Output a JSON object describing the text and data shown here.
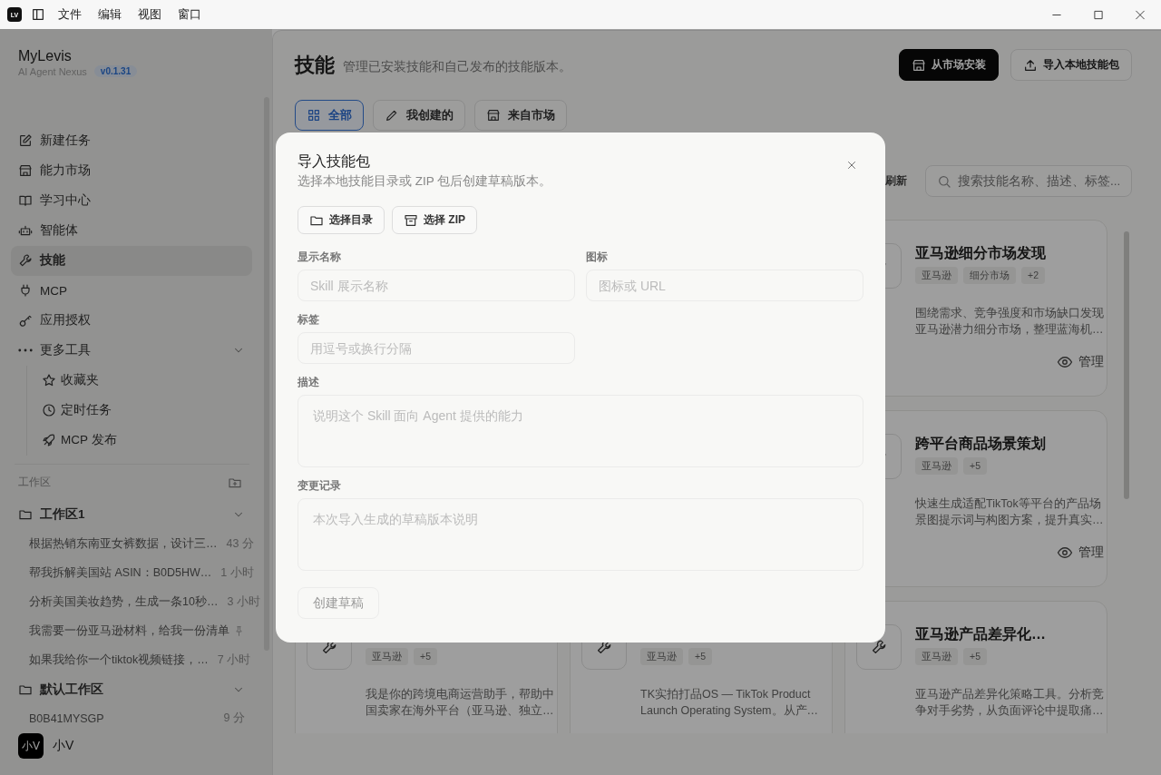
{
  "titlebar": {
    "logo": "LV",
    "menus": [
      "文件",
      "编辑",
      "视图",
      "窗口"
    ]
  },
  "sidebar": {
    "brand": "MyLevis",
    "tagline": "AI Agent Nexus",
    "version": "v0.1.31",
    "nav": [
      {
        "label": "新建任务",
        "selected": false
      },
      {
        "label": "能力市场",
        "selected": false
      },
      {
        "label": "学习中心",
        "selected": false
      },
      {
        "label": "智能体",
        "selected": false
      },
      {
        "label": "技能",
        "selected": true
      },
      {
        "label": "MCP",
        "selected": false
      },
      {
        "label": "应用授权",
        "selected": false
      },
      {
        "label": "更多工具",
        "selected": false,
        "expanded": true,
        "children": [
          {
            "label": "收藏夹",
            "selected": false
          },
          {
            "label": "定时任务",
            "selected": false
          },
          {
            "label": "MCP 发布",
            "selected": false
          }
        ]
      }
    ],
    "workspace_heading": "工作区",
    "workspaces": [
      {
        "name": "工作区1",
        "expanded": true,
        "tasks": [
          {
            "title": "根据热销东南亚女裤数据，设计三…",
            "time": "43 分",
            "pinned": false
          },
          {
            "title": "帮我拆解美国站 ASIN：B0D5HW…",
            "time": "1 小时",
            "pinned": false
          },
          {
            "title": "分析美国美妆趋势，生成一条10秒…",
            "time": "3 小时",
            "pinned": false
          },
          {
            "title": "我需要一份亚马逊材料，给我一份清单",
            "pinned": true
          },
          {
            "title": "如果我给你一个tiktok视频链接，…",
            "time": "7 小时",
            "pinned": false
          }
        ]
      },
      {
        "name": "默认工作区",
        "expanded": true,
        "tasks": [
          {
            "title": "B0B41MYSGP",
            "time": "9 分",
            "pinned": false
          }
        ]
      }
    ],
    "user": {
      "avatar": "小V",
      "name": "小V"
    }
  },
  "page": {
    "title": "技能",
    "subtitle": "管理已安装技能和自己发布的技能版本。",
    "actions": [
      {
        "label": "从市场安装",
        "kind": "primary"
      },
      {
        "label": "导入本地技能包",
        "kind": "secondary"
      }
    ],
    "tabs": [
      {
        "label": "全部",
        "selected": true
      },
      {
        "label": "我创建的",
        "selected": false
      },
      {
        "label": "来自市场",
        "selected": false
      }
    ],
    "refresh": "刷新",
    "search": {
      "placeholder": "搜索技能名称、描述、标签..."
    },
    "cards": [
      {
        "title": "亚马逊细分市场发现",
        "tags": [
          "亚马逊",
          "细分市场",
          "+2"
        ],
        "description": [
          "围绕需求、竞争强度和市场缺口发现",
          "亚马逊潜力细分市场，整理蓝海机…"
        ],
        "manage": "管理"
      },
      {
        "title": "跨平台商品场景策划",
        "tags": [
          "亚马逊",
          "+5"
        ],
        "description": [
          "快速生成适配TikTok等平台的产品场",
          "景图提示词与构图方案，提升真实…"
        ],
        "manage": "管理"
      },
      {
        "tags": [
          "亚马逊",
          "+5"
        ],
        "description": [
          "我是你的跨境电商运营助手，帮助中",
          "国卖家在海外平台（亚马逊、独立…"
        ]
      },
      {
        "tags": [
          "亚马逊",
          "+5"
        ],
        "description": [
          "TK实拍打品OS — TikTok Product",
          "Launch Operating System。从产…"
        ]
      },
      {
        "title": "亚马逊产品差异化…",
        "tags": [
          "亚马逊",
          "+5"
        ],
        "description": [
          "亚马逊产品差异化策略工具。分析竞",
          "争对手劣势，从负面评论中提取痛…"
        ]
      }
    ]
  },
  "dialog": {
    "title": "导入技能包",
    "subtitle": "选择本地技能目录或 ZIP 包后创建草稿版本。",
    "sources": [
      "选择目录",
      "选择 ZIP"
    ],
    "fields": [
      {
        "label": "显示名称",
        "kind": "input",
        "placeholder": "Skill 展示名称"
      },
      {
        "label": "图标",
        "kind": "input",
        "placeholder": "图标或 URL"
      },
      {
        "label": "标签",
        "kind": "input",
        "placeholder": "用逗号或换行分隔"
      },
      {
        "label": "描述",
        "kind": "textarea",
        "placeholder": "说明这个 Skill 面向 Agent 提供的能力"
      },
      {
        "label": "变更记录",
        "kind": "textarea",
        "placeholder": "本次导入生成的草稿版本说明"
      }
    ],
    "submit": {
      "label": "创建草稿",
      "disabled": true
    }
  }
}
